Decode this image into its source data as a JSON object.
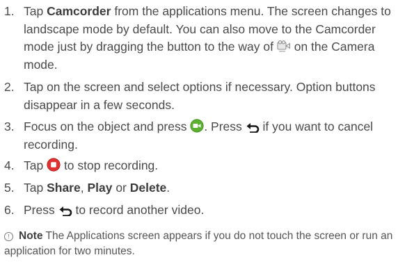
{
  "steps": [
    {
      "num": "1.",
      "t1": "Tap ",
      "b1": "Camcorder",
      "t2": " from the applications menu. The screen changes to landscape mode by default. You can also move to the Camcorder mode just by dragging the button to the way of ",
      "t3": " on the Camera mode."
    },
    {
      "num": "2.",
      "t1": "Tap on the screen and select options if necessary. Option buttons disappear in a few seconds."
    },
    {
      "num": "3.",
      "t1": "Focus on the object and press ",
      "t2": ". Press ",
      "t3": " if you want to cancel recording."
    },
    {
      "num": "4.",
      "t1": "Tap ",
      "t2": " to stop recording."
    },
    {
      "num": "5.",
      "t1": "Tap ",
      "b1": "Share",
      "t2": ", ",
      "b2": "Play",
      "t3": " or ",
      "b3": "Delete",
      "t4": "."
    },
    {
      "num": "6.",
      "t1": "Press ",
      "t2": " to record another video."
    }
  ],
  "note": {
    "icon_glyph": "!",
    "label": "Note",
    "text": " The Applications screen appears if you do not touch the screen or run an application for two minutes."
  },
  "icons": {
    "camcorder_mode": "camcorder-mode-icon",
    "record": "record-button-icon",
    "back": "back-arrow-icon",
    "stop": "stop-button-icon"
  },
  "colors": {
    "text": "#4a4a4a",
    "record_green": "#5cb030",
    "stop_red": "#e03131"
  }
}
